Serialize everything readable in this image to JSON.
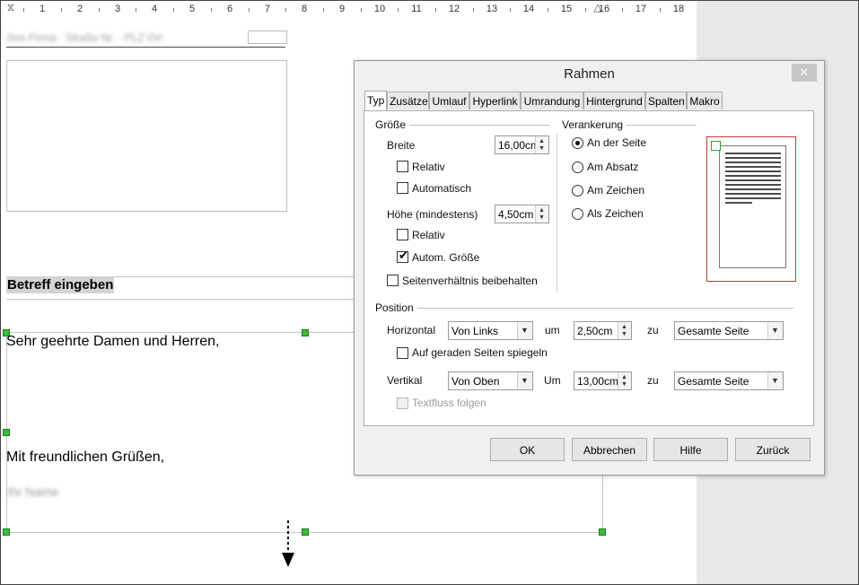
{
  "ruler": {
    "labels": [
      "1",
      "2",
      "3",
      "4",
      "5",
      "6",
      "7",
      "8",
      "9",
      "10",
      "11",
      "12",
      "13",
      "14",
      "15",
      "16",
      "17",
      "18"
    ]
  },
  "document": {
    "header_blurred": "Ihre Firma · Straße Nr. · PLZ Ort",
    "subject": "Betreff eingeben",
    "salutation": "Sehr geehrte Damen und Herren,",
    "closing": "Mit freundlichen Grüßen,",
    "signature_blurred": "Ihr Name"
  },
  "dialog": {
    "title": "Rahmen",
    "close": "✕",
    "tabs": [
      "Typ",
      "Zusätze",
      "Umlauf",
      "Hyperlink",
      "Umrandung",
      "Hintergrund",
      "Spalten",
      "Makro"
    ],
    "size": {
      "group": "Größe",
      "width_label": "Breite",
      "width_value": "16,00cm",
      "relative1": "Relativ",
      "automatic": "Automatisch",
      "height_label": "Höhe (mindestens)",
      "height_value": "4,50cm",
      "relative2": "Relativ",
      "auto_size": "Autom. Größe",
      "keep_ratio": "Seitenverhältnis beibehalten"
    },
    "anchor": {
      "group": "Verankerung",
      "options": [
        "An der Seite",
        "Am Absatz",
        "Am Zeichen",
        "Als Zeichen"
      ]
    },
    "position": {
      "group": "Position",
      "horizontal_label": "Horizontal",
      "horizontal_value": "Von Links",
      "by_label": "um",
      "horizontal_by": "2,50cm",
      "to_label": "zu",
      "horizontal_to": "Gesamte Seite",
      "mirror": "Auf geraden Seiten spiegeln",
      "vertical_label": "Vertikal",
      "vertical_value": "Von Oben",
      "by_label2": "Um",
      "vertical_by": "13,00cm",
      "to_label2": "zu",
      "vertical_to": "Gesamte Seite",
      "follow_text": "Textfluss folgen"
    },
    "buttons": {
      "ok": "OK",
      "cancel": "Abbrechen",
      "help": "Hilfe",
      "reset": "Zurück"
    }
  },
  "colors": {
    "handle": "#3dbb3d",
    "preview_border": "#c43a3a"
  }
}
